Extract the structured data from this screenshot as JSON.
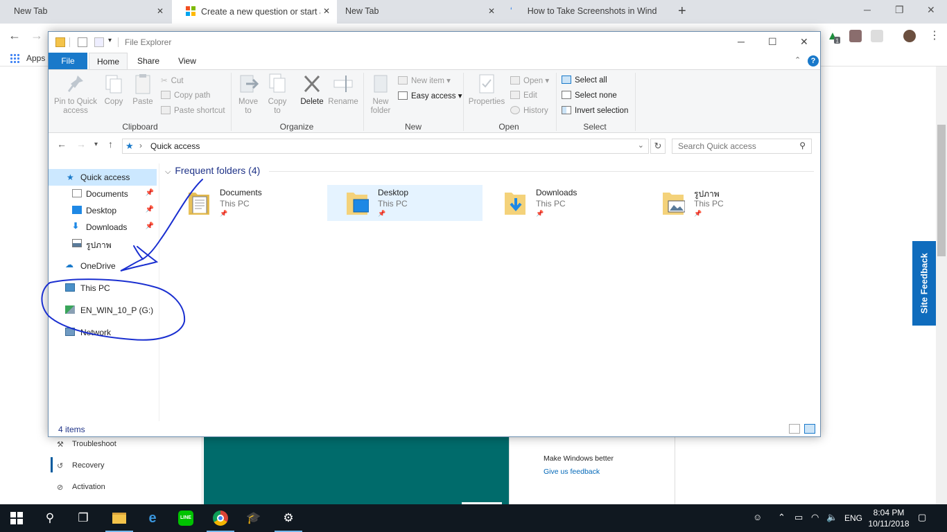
{
  "browser": {
    "tabs": [
      {
        "title": "New Tab"
      },
      {
        "title": "Create a new question or start a"
      },
      {
        "title": "New Tab"
      },
      {
        "title": "How to Take Screenshots in Wind"
      }
    ],
    "bookmarks": {
      "apps_label": "Apps"
    },
    "extension_badge": "1"
  },
  "explorer": {
    "title": "File Explorer",
    "ribbon_tabs": {
      "file": "File",
      "home": "Home",
      "share": "Share",
      "view": "View"
    },
    "clipboard": {
      "pin_label": "Pin to Quick access",
      "copy_label": "Copy",
      "paste_label": "Paste",
      "cut_label": "Cut",
      "copy_path_label": "Copy path",
      "paste_shortcut_label": "Paste shortcut",
      "group_label": "Clipboard"
    },
    "organize": {
      "move_to_label": "Move to",
      "copy_to_label": "Copy to",
      "delete_label": "Delete",
      "rename_label": "Rename",
      "group_label": "Organize"
    },
    "new": {
      "new_folder_label": "New folder",
      "new_item_label": "New item",
      "easy_access_label": "Easy access",
      "group_label": "New"
    },
    "open": {
      "properties_label": "Properties",
      "open_label": "Open",
      "edit_label": "Edit",
      "history_label": "History",
      "group_label": "Open"
    },
    "select": {
      "select_all_label": "Select all",
      "select_none_label": "Select none",
      "invert_selection_label": "Invert selection",
      "group_label": "Select"
    },
    "address": {
      "current": "Quick access"
    },
    "search": {
      "placeholder": "Search Quick access"
    },
    "nav": {
      "quick_access": "Quick access",
      "documents": "Documents",
      "desktop": "Desktop",
      "downloads": "Downloads",
      "pictures": "รูปภาพ",
      "onedrive": "OneDrive",
      "this_pc": "This PC",
      "drive_g": "EN_WIN_10_P (G:)",
      "network": "Network"
    },
    "frequent": {
      "header": "Frequent folders (4)",
      "items": [
        {
          "name": "Documents",
          "location": "This PC"
        },
        {
          "name": "Desktop",
          "location": "This PC"
        },
        {
          "name": "Downloads",
          "location": "This PC"
        },
        {
          "name": "รูปภาพ",
          "location": "This PC"
        }
      ]
    },
    "status": {
      "item_count": "4 items"
    }
  },
  "background_page": {
    "sidebar": {
      "troubleshoot": "Troubleshoot",
      "recovery": "Recovery",
      "activation": "Activation"
    },
    "make_windows_better": "Make Windows better",
    "give_feedback": "Give us feedback",
    "site_feedback": "Site Feedback"
  },
  "taskbar": {
    "language": "ENG",
    "time": "8:04 PM",
    "date": "10/11/2018"
  },
  "colors": {
    "ribbon_file_tab": "#1979ca",
    "selection": "#cce8ff",
    "annotation_ink": "#1a2fd0",
    "taskbar": "#101820",
    "teal_panel": "#006b6b"
  }
}
